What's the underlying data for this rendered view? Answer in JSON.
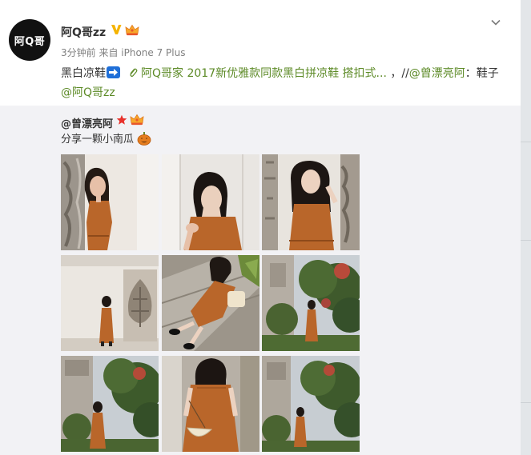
{
  "author": {
    "avatar_text": "阿Q哥",
    "name": "阿Q哥zz",
    "meta": "3分钟前 来自 iPhone 7 Plus"
  },
  "post": {
    "text_start": "黑白凉鞋",
    "link_text": "阿Q哥家 2017新优雅款同款黑白拼凉鞋 搭扣式...",
    "sep": " ，//",
    "mention1": "@曾漂亮阿",
    "mid": "：鞋子",
    "mention2": "@阿Q哥zz"
  },
  "repost": {
    "user": "@曾漂亮阿",
    "text": "分享一颗小南瓜"
  },
  "icons": {
    "verified": "verified-v-icon",
    "member": "member-crown-icon",
    "arrow": "right-arrow-emoji-icon",
    "link": "paperclip-link-icon",
    "chevron": "chevron-down-icon",
    "star": "star-badge-icon",
    "pumpkin": "pumpkin-emoji-icon"
  },
  "colors": {
    "link": "#5c8a26",
    "verified": "#f5b400",
    "dress": "#b9662a",
    "repost_bg": "#f2f2f5"
  },
  "photos": [
    {
      "name": "photo-1",
      "scene": "wall-carving-lean"
    },
    {
      "name": "photo-2",
      "scene": "white-wall-closeup"
    },
    {
      "name": "photo-3",
      "scene": "column-hair-touch"
    },
    {
      "name": "photo-4",
      "scene": "white-wall-full"
    },
    {
      "name": "photo-5",
      "scene": "steps-sitting"
    },
    {
      "name": "photo-6",
      "scene": "garden-trees"
    },
    {
      "name": "photo-7",
      "scene": "garden-standing"
    },
    {
      "name": "photo-8",
      "scene": "back-view-basket"
    },
    {
      "name": "photo-9",
      "scene": "garden-far"
    }
  ]
}
